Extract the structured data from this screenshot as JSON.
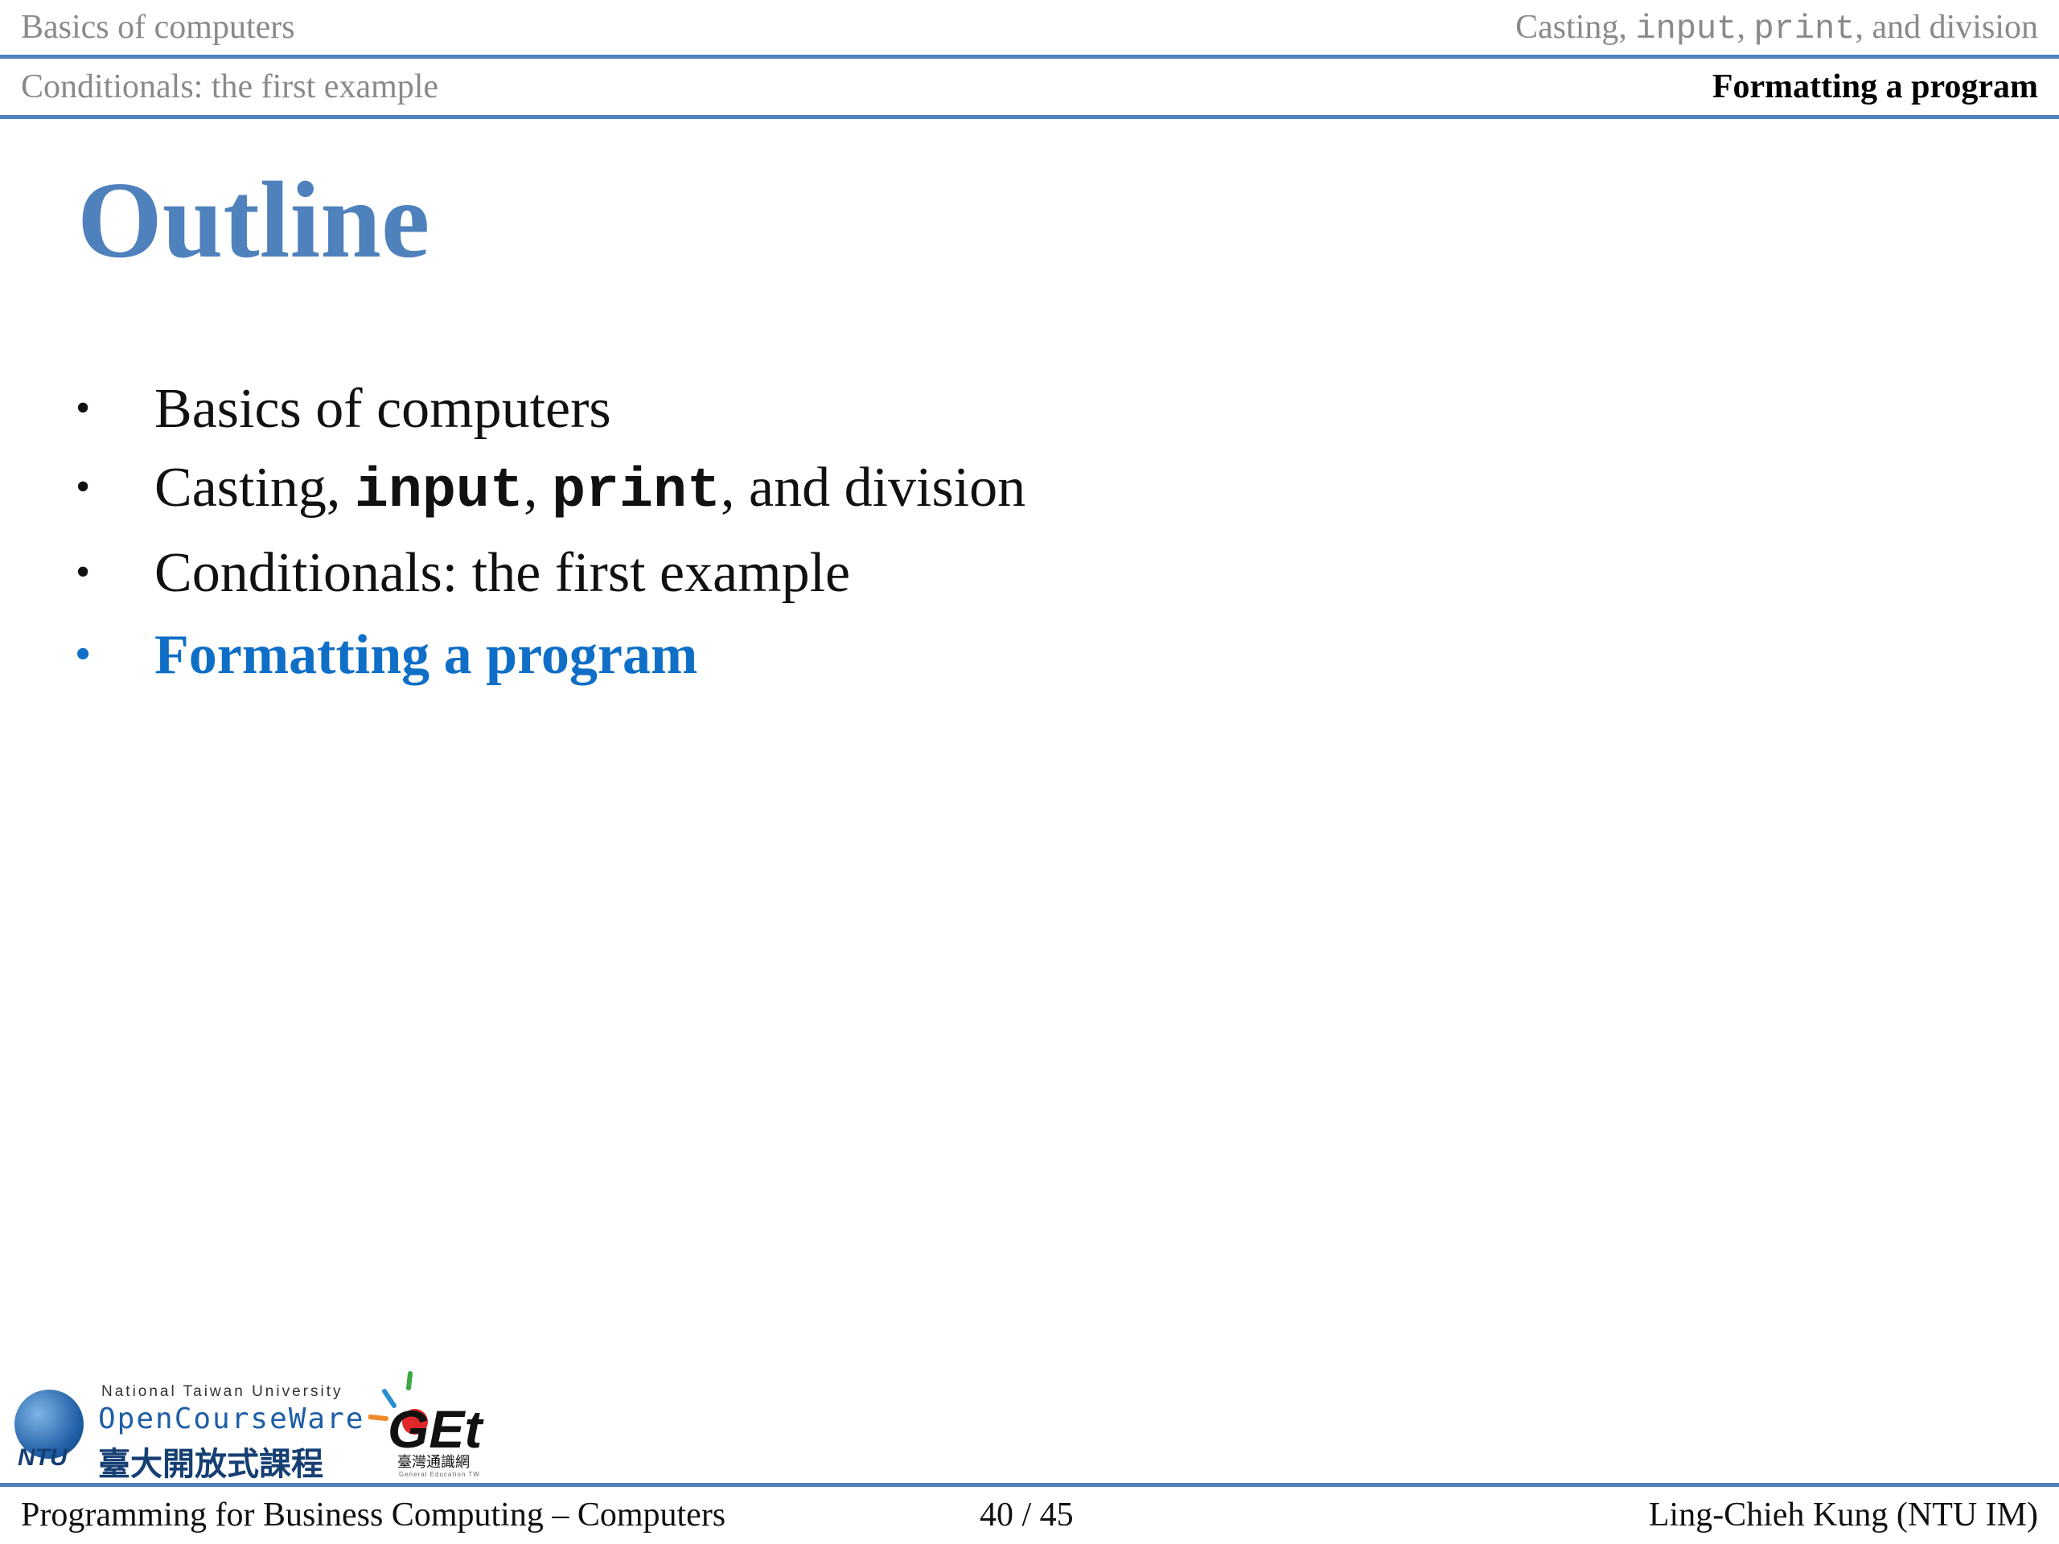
{
  "header": {
    "sections": [
      "Basics of computers",
      {
        "prefix": "Casting, ",
        "code1": "input",
        "sep": ", ",
        "code2": "print",
        "suffix": ", and division"
      },
      "Conditionals: the first example",
      "Formatting a program"
    ]
  },
  "slide": {
    "title": "Outline",
    "items": [
      {
        "text": "Basics of computers"
      },
      {
        "prefix": "Casting, ",
        "code1": "input",
        "sep": ", ",
        "code2": "print",
        "suffix": ", and division"
      },
      {
        "text": "Conditionals: the first example"
      },
      {
        "text": "Formatting a program",
        "current": true
      }
    ],
    "bullet": "•"
  },
  "logos": {
    "ntu": "NTU",
    "ocw_university": "National Taiwan University",
    "ocw_name": "OpenCourseWare",
    "ocw_chinese": "臺大開放式課程",
    "get_text": "GEt",
    "get_chinese": "臺灣通識網",
    "get_english": "General Education TW"
  },
  "footer": {
    "left": "Programming for Business Computing – Computers",
    "center": "40 / 45",
    "right": "Ling-Chieh Kung (NTU IM)"
  },
  "colors": {
    "accent": "#4f81bd",
    "current_item": "#0f6fc6",
    "header_inactive": "#8a8a8a"
  }
}
